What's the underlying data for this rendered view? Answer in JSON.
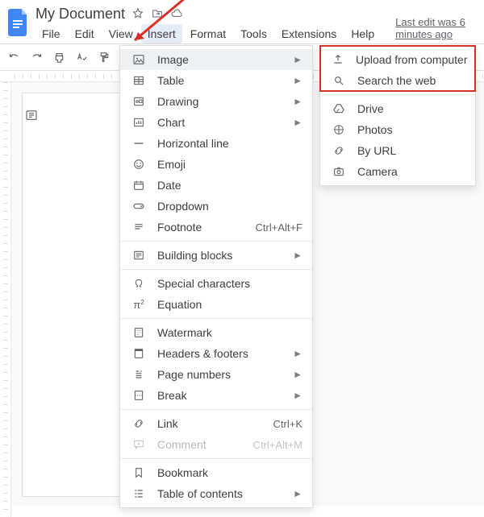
{
  "header": {
    "title": "My Document",
    "last_edit": "Last edit was 6 minutes ago"
  },
  "menubar": [
    "File",
    "Edit",
    "View",
    "Insert",
    "Format",
    "Tools",
    "Extensions",
    "Help"
  ],
  "menubar_active_index": 3,
  "insert_menu": {
    "groups": [
      [
        {
          "icon": "image",
          "label": "Image",
          "hover": true,
          "submenu": true
        },
        {
          "icon": "table",
          "label": "Table",
          "submenu": true
        },
        {
          "icon": "drawing",
          "label": "Drawing",
          "submenu": true
        },
        {
          "icon": "chart",
          "label": "Chart",
          "submenu": true
        },
        {
          "icon": "hr",
          "label": "Horizontal line"
        },
        {
          "icon": "emoji",
          "label": "Emoji"
        },
        {
          "icon": "date",
          "label": "Date"
        },
        {
          "icon": "dropdown",
          "label": "Dropdown"
        },
        {
          "icon": "footnote",
          "label": "Footnote",
          "shortcut": "Ctrl+Alt+F"
        }
      ],
      [
        {
          "icon": "blocks",
          "label": "Building blocks",
          "submenu": true
        }
      ],
      [
        {
          "icon": "omega",
          "label": "Special characters"
        },
        {
          "icon": "equation",
          "label": "Equation"
        }
      ],
      [
        {
          "icon": "watermark",
          "label": "Watermark"
        },
        {
          "icon": "headers",
          "label": "Headers & footers",
          "submenu": true
        },
        {
          "icon": "pagenum",
          "label": "Page numbers",
          "submenu": true
        },
        {
          "icon": "break",
          "label": "Break",
          "submenu": true
        }
      ],
      [
        {
          "icon": "link",
          "label": "Link",
          "shortcut": "Ctrl+K"
        },
        {
          "icon": "comment",
          "label": "Comment",
          "shortcut": "Ctrl+Alt+M",
          "disabled": true
        }
      ],
      [
        {
          "icon": "bookmark",
          "label": "Bookmark"
        },
        {
          "icon": "toc",
          "label": "Table of contents",
          "submenu": true
        }
      ]
    ]
  },
  "image_submenu": {
    "highlight_count": 2,
    "groups": [
      [
        {
          "icon": "upload",
          "label": "Upload from computer"
        },
        {
          "icon": "search",
          "label": "Search the web"
        }
      ],
      [
        {
          "icon": "drive",
          "label": "Drive"
        },
        {
          "icon": "photos",
          "label": "Photos"
        },
        {
          "icon": "url",
          "label": "By URL"
        },
        {
          "icon": "camera",
          "label": "Camera"
        }
      ]
    ]
  }
}
